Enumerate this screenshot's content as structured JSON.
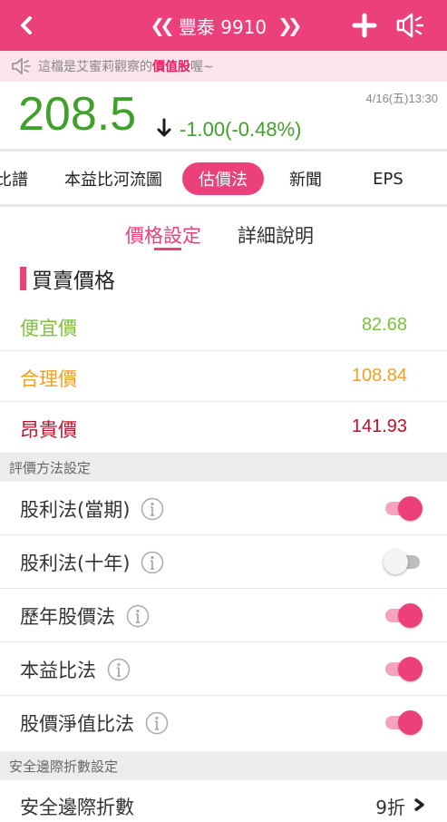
{
  "header": {
    "title": "豐泰 9910",
    "prev_icon": "double-chevron-left-icon",
    "next_icon": "double-chevron-right-icon",
    "bg_color": "#ec407a"
  },
  "notice": {
    "prefix": "這檔是艾蜜莉觀察的",
    "highlight": "價值股",
    "suffix": "喔~"
  },
  "quote": {
    "price": "208.5",
    "change": "-1.00(-0.48%)",
    "datetime": "4/16(五)13:30",
    "color": "#3fa02a"
  },
  "tabs": [
    {
      "label": "比譜"
    },
    {
      "label": "本益比河流圖"
    },
    {
      "label": "估價法",
      "active": true
    },
    {
      "label": "新聞"
    },
    {
      "label": "EPS"
    }
  ],
  "subtabs": [
    {
      "label": "價格設定",
      "active": true
    },
    {
      "label": "詳細說明",
      "active": false
    }
  ],
  "prices": {
    "heading": "買賣價格",
    "rows": [
      {
        "label": "便宜價",
        "value": "82.68",
        "color": "#7cc13c"
      },
      {
        "label": "合理價",
        "value": "108.84",
        "color": "#f0a020"
      },
      {
        "label": "昂貴價",
        "value": "141.93",
        "color": "#c0102a"
      }
    ]
  },
  "methods": {
    "heading": "評價方法設定",
    "rows": [
      {
        "label": "股利法(當期)",
        "enabled": true
      },
      {
        "label": "股利法(十年)",
        "enabled": false
      },
      {
        "label": "歷年股價法",
        "enabled": true
      },
      {
        "label": "本益比法",
        "enabled": true
      },
      {
        "label": "股價淨值比法",
        "enabled": true
      }
    ]
  },
  "safety": {
    "heading": "安全邊際折數設定",
    "label": "安全邊際折數",
    "value": "9折"
  }
}
